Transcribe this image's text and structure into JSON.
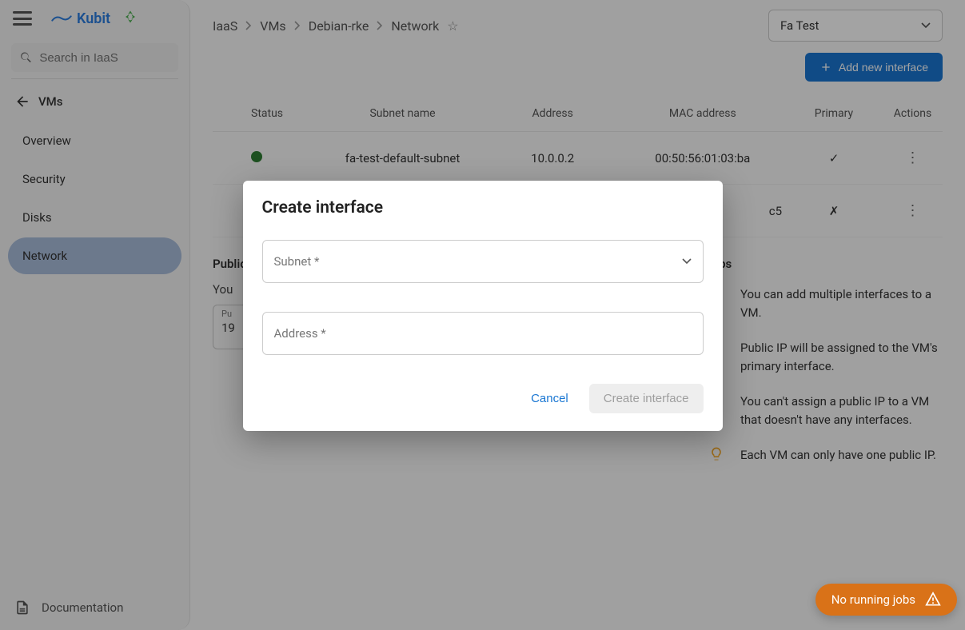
{
  "brand": "Kubit",
  "search_placeholder": "Search in IaaS",
  "back_label": "VMs",
  "nav": [
    {
      "label": "Overview"
    },
    {
      "label": "Security"
    },
    {
      "label": "Disks"
    },
    {
      "label": "Network"
    }
  ],
  "doc_label": "Documentation",
  "breadcrumb": [
    "IaaS",
    "VMs",
    "Debian-rke",
    "Network"
  ],
  "project": "Fa Test",
  "add_interface_btn": "Add new interface",
  "table": {
    "headers": {
      "status": "Status",
      "subnet": "Subnet name",
      "address": "Address",
      "mac": "MAC address",
      "primary": "Primary",
      "actions": "Actions"
    },
    "rows": [
      {
        "subnet": "fa-test-default-subnet",
        "address": "10.0.0.2",
        "mac": "00:50:56:01:03:ba",
        "primary": "✓"
      },
      {
        "subnet": "",
        "address": "",
        "mac": "c5",
        "primary": "✗"
      }
    ]
  },
  "public_ip": {
    "title": "Public IP",
    "text": "You",
    "field_label": "Pu",
    "field_value": "19"
  },
  "tips": {
    "title": "Tips",
    "items": [
      "You can add multiple interfaces to a VM.",
      "Public IP will be assigned to the VM's primary interface.",
      "You can't assign a public IP to a VM that doesn't have any interfaces.",
      "Each VM can only have one public IP."
    ]
  },
  "modal": {
    "title": "Create interface",
    "subnet_label": "Subnet *",
    "address_label": "Address *",
    "cancel": "Cancel",
    "confirm": "Create interface"
  },
  "jobs": "No running jobs"
}
